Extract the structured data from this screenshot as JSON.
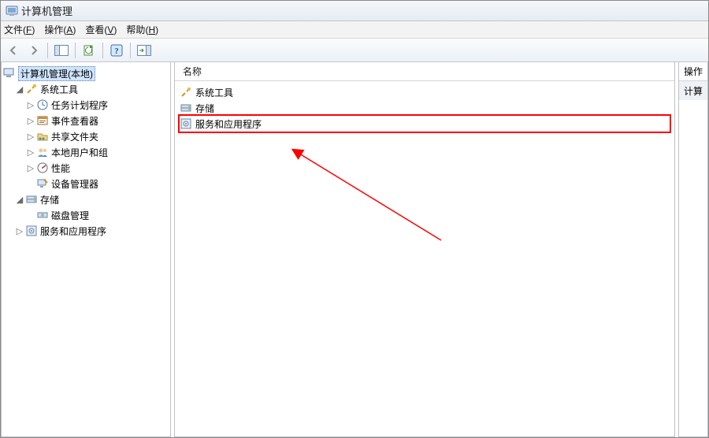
{
  "title": "计算机管理",
  "menu": {
    "file": {
      "label": "文件",
      "accel": "F"
    },
    "action": {
      "label": "操作",
      "accel": "A"
    },
    "view": {
      "label": "查看",
      "accel": "V"
    },
    "help": {
      "label": "帮助",
      "accel": "H"
    }
  },
  "tree": {
    "root": "计算机管理(本地)",
    "system_tools": "系统工具",
    "task_scheduler": "任务计划程序",
    "event_viewer": "事件查看器",
    "shared_folders": "共享文件夹",
    "local_users_groups": "本地用户和组",
    "performance": "性能",
    "device_manager": "设备管理器",
    "storage": "存储",
    "disk_management": "磁盘管理",
    "services_apps": "服务和应用程序"
  },
  "list": {
    "header_name": "名称",
    "row_system_tools": "系统工具",
    "row_storage": "存储",
    "row_services_apps": "服务和应用程序"
  },
  "right": {
    "header": "操作",
    "item": "计算"
  }
}
